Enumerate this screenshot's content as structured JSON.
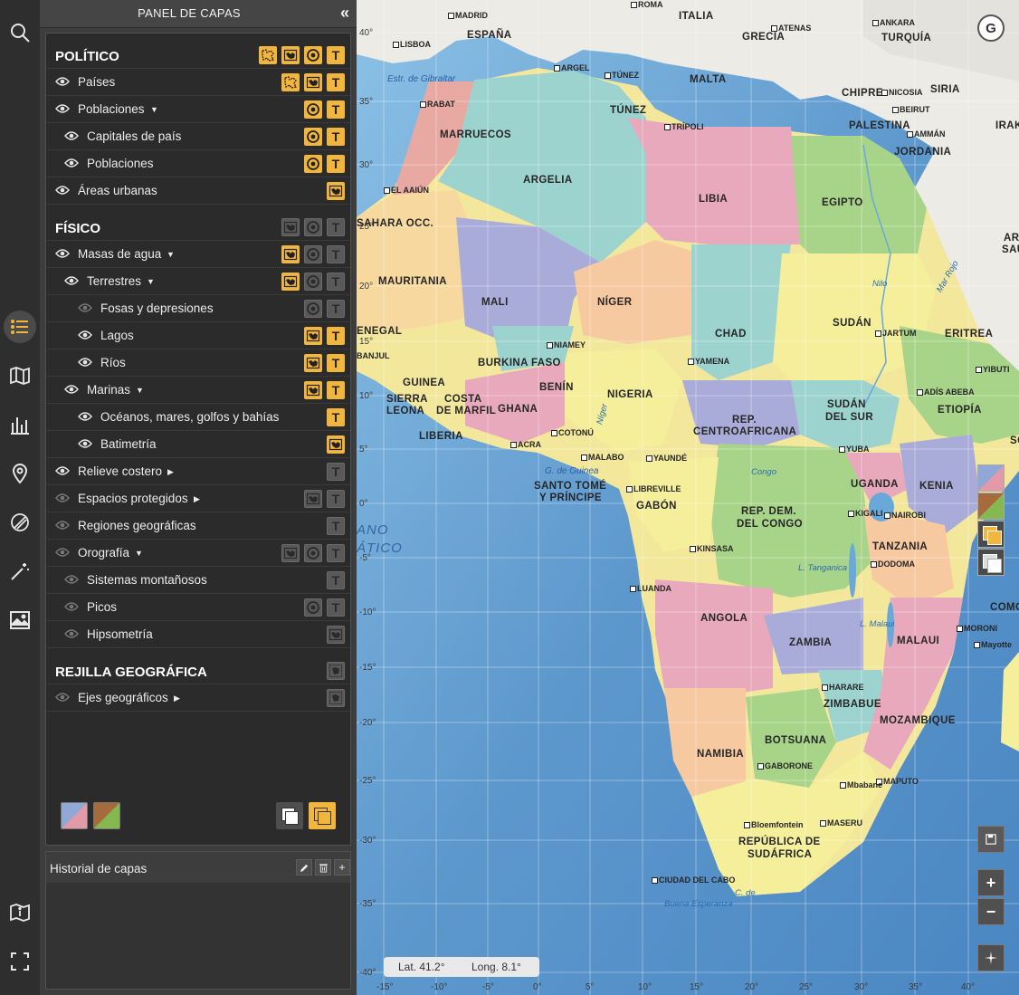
{
  "toolbar": {
    "tools": [
      {
        "name": "search-icon"
      },
      {
        "name": "layers-list-icon"
      },
      {
        "name": "map-catalog-icon"
      },
      {
        "name": "statistics-icon"
      },
      {
        "name": "location-pin-icon"
      },
      {
        "name": "drawing-icon"
      },
      {
        "name": "magic-wand-icon"
      },
      {
        "name": "image-icon"
      },
      {
        "name": "map-info-icon"
      },
      {
        "name": "fullscreen-icon"
      }
    ],
    "active_tool": "layers-list-icon",
    "accent": "#f2b63c"
  },
  "panel": {
    "title": "PANEL DE CAPAS",
    "collapse_glyph": "«"
  },
  "layers": [
    {
      "label": "POLÍTICO",
      "section": true,
      "btns": [
        [
          "areas",
          "on"
        ],
        [
          "map",
          "on"
        ],
        [
          "points",
          "on"
        ],
        [
          "text",
          "on"
        ]
      ]
    },
    {
      "label": "Países",
      "eye": "on",
      "indent": 0,
      "btns": [
        [
          "areas",
          "on"
        ],
        [
          "map",
          "on"
        ],
        [
          "text",
          "on"
        ]
      ]
    },
    {
      "label": "Poblaciones",
      "eye": "on",
      "indent": 0,
      "caret": "down",
      "btns": [
        [
          "points",
          "on"
        ],
        [
          "text",
          "on"
        ]
      ]
    },
    {
      "label": "Capitales de país",
      "eye": "on",
      "indent": 1,
      "btns": [
        [
          "points",
          "on"
        ],
        [
          "text",
          "on"
        ]
      ]
    },
    {
      "label": "Poblaciones",
      "eye": "on",
      "indent": 1,
      "btns": [
        [
          "points",
          "on"
        ],
        [
          "text",
          "on"
        ]
      ]
    },
    {
      "label": "Áreas urbanas",
      "eye": "on",
      "indent": 0,
      "btns": [
        [
          "map",
          "on"
        ]
      ]
    },
    {
      "label": "FÍSICO",
      "section": true,
      "btns": [
        [
          "map",
          "off"
        ],
        [
          "points",
          "off"
        ],
        [
          "text",
          "off"
        ]
      ]
    },
    {
      "label": "Masas de agua",
      "eye": "on",
      "indent": 0,
      "caret": "down",
      "btns": [
        [
          "map",
          "on"
        ],
        [
          "points",
          "off"
        ],
        [
          "text",
          "off"
        ]
      ]
    },
    {
      "label": "Terrestres",
      "eye": "on",
      "indent": 1,
      "caret": "down",
      "btns": [
        [
          "map",
          "on"
        ],
        [
          "points",
          "off"
        ],
        [
          "text",
          "off"
        ]
      ]
    },
    {
      "label": "Fosas y depresiones",
      "eye": "dim",
      "indent": 2,
      "btns": [
        [
          "points",
          "off"
        ],
        [
          "text",
          "off"
        ]
      ]
    },
    {
      "label": "Lagos",
      "eye": "on",
      "indent": 2,
      "btns": [
        [
          "map",
          "on"
        ],
        [
          "text",
          "on"
        ]
      ]
    },
    {
      "label": "Ríos",
      "eye": "on",
      "indent": 2,
      "btns": [
        [
          "map",
          "on"
        ],
        [
          "text",
          "on"
        ]
      ]
    },
    {
      "label": "Marinas",
      "eye": "on",
      "indent": 1,
      "caret": "down",
      "btns": [
        [
          "map",
          "on"
        ],
        [
          "text",
          "on"
        ]
      ]
    },
    {
      "label": "Océanos, mares, golfos y bahías",
      "eye": "on",
      "indent": 2,
      "btns": [
        [
          "text",
          "on"
        ]
      ]
    },
    {
      "label": "Batimetría",
      "eye": "on",
      "indent": 2,
      "btns": [
        [
          "map",
          "on"
        ]
      ]
    },
    {
      "label": "Relieve costero",
      "eye": "on",
      "indent": 0,
      "caret": "right",
      "btns": [
        [
          "text",
          "off"
        ]
      ]
    },
    {
      "label": "Espacios protegidos",
      "eye": "dim",
      "indent": 0,
      "caret": "right",
      "btns": [
        [
          "map",
          "off"
        ],
        [
          "text",
          "off"
        ]
      ]
    },
    {
      "label": "Regiones geográficas",
      "eye": "dim",
      "indent": 0,
      "btns": [
        [
          "text",
          "off"
        ]
      ]
    },
    {
      "label": "Orografía",
      "eye": "dim",
      "indent": 0,
      "caret": "down",
      "btns": [
        [
          "map",
          "off"
        ],
        [
          "points",
          "off"
        ],
        [
          "text",
          "off"
        ]
      ]
    },
    {
      "label": "Sistemas montañosos",
      "eye": "dim",
      "indent": 1,
      "btns": [
        [
          "text",
          "off"
        ]
      ]
    },
    {
      "label": "Picos",
      "eye": "dim",
      "indent": 1,
      "btns": [
        [
          "points",
          "off"
        ],
        [
          "text",
          "off"
        ]
      ]
    },
    {
      "label": "Hipsometría",
      "eye": "dim",
      "indent": 1,
      "btns": [
        [
          "map",
          "off"
        ]
      ]
    },
    {
      "label": "REJILLA GEOGRÁFICA",
      "section": true,
      "btns": [
        [
          "grid",
          "off"
        ]
      ]
    },
    {
      "label": "Ejes geográficos",
      "eye": "dim",
      "indent": 0,
      "caret": "right",
      "btns": [
        [
          "grid",
          "off"
        ]
      ]
    }
  ],
  "history": {
    "title": "Historial de capas",
    "edit_icon": "pencil-icon",
    "delete_icon": "trash-icon",
    "add_label": "+"
  },
  "map": {
    "countries": [
      {
        "t": "ESPAÑA"
      },
      {
        "t": "ITALIA"
      },
      {
        "t": "GRECIA"
      },
      {
        "t": "TURQUÍA"
      },
      {
        "t": "MALTA"
      },
      {
        "t": "CHIPRE"
      },
      {
        "t": "SIRIA"
      },
      {
        "t": "IRAK"
      },
      {
        "t": "PALESTINA"
      },
      {
        "t": "JORDANIA"
      },
      {
        "t": "TÚNEZ"
      },
      {
        "t": "MARRUECOS"
      },
      {
        "t": "ARGELIA"
      },
      {
        "t": "LIBIA"
      },
      {
        "t": "EGIPTO"
      },
      {
        "t": "ARABIA"
      },
      {
        "t": "SAUD"
      },
      {
        "t": "SAHARA OCC."
      },
      {
        "t": "MAURITANIA"
      },
      {
        "t": "MALI"
      },
      {
        "t": "NÍGER"
      },
      {
        "t": "CHAD"
      },
      {
        "t": "SUDÁN"
      },
      {
        "t": "ENEGAL"
      },
      {
        "t": "ERITREA"
      },
      {
        "t": "BURKINA FASO"
      },
      {
        "t": "GUINEA"
      },
      {
        "t": "SIERRA"
      },
      {
        "t": "LEONA"
      },
      {
        "t": "COSTA"
      },
      {
        "t": "DE MARFIL"
      },
      {
        "t": "LIBERIA"
      },
      {
        "t": "GHANA"
      },
      {
        "t": "BENÍN"
      },
      {
        "t": "NIGERIA"
      },
      {
        "t": "REP."
      },
      {
        "t": "CENTROAFRICANA"
      },
      {
        "t": "SUDÁN"
      },
      {
        "t": "DEL SUR"
      },
      {
        "t": "ETIOPÍA"
      },
      {
        "t": "SO"
      },
      {
        "t": "SANTO TOMÉ"
      },
      {
        "t": "Y PRÍNCIPE"
      },
      {
        "t": "GABÓN"
      },
      {
        "t": "REP. DEM."
      },
      {
        "t": "DEL CONGO"
      },
      {
        "t": "UGANDA"
      },
      {
        "t": "KENIA"
      },
      {
        "t": "TANZANIA"
      },
      {
        "t": "ANGOLA"
      },
      {
        "t": "ZAMBIA"
      },
      {
        "t": "MALAUI"
      },
      {
        "t": "ZIMBABUE"
      },
      {
        "t": "MOZAMBIQUE"
      },
      {
        "t": "NAMIBIA"
      },
      {
        "t": "BOTSUANA"
      },
      {
        "t": "REPÚBLICA DE"
      },
      {
        "t": "SUDÁFRICA"
      },
      {
        "t": "COMORAS"
      }
    ],
    "cities": [
      {
        "t": "MADRID"
      },
      {
        "t": "ROMA"
      },
      {
        "t": "LISBOA"
      },
      {
        "t": "ATENAS"
      },
      {
        "t": "ANKARA"
      },
      {
        "t": "NICOSIA"
      },
      {
        "t": "BEIRUT"
      },
      {
        "t": "AMMÁN"
      },
      {
        "t": "ARGEL"
      },
      {
        "t": "TÚNEZ"
      },
      {
        "t": "RABAT"
      },
      {
        "t": "TRÍPOLI"
      },
      {
        "t": "EL AAIÚN"
      },
      {
        "t": "JARTUM"
      },
      {
        "t": "NIAMEY"
      },
      {
        "t": "YAMENA"
      },
      {
        "t": "ADÍS ABEBA"
      },
      {
        "t": "YIBUTI"
      },
      {
        "t": "ACRA"
      },
      {
        "t": "COTONÚ"
      },
      {
        "t": "MALABO"
      },
      {
        "t": "YAUNDÉ"
      },
      {
        "t": "LIBREVILLE"
      },
      {
        "t": "YUBA"
      },
      {
        "t": "KIGALI"
      },
      {
        "t": "NAIROBI"
      },
      {
        "t": "KINSASA"
      },
      {
        "t": "DODOMA"
      },
      {
        "t": "LUANDA"
      },
      {
        "t": "MORONI"
      },
      {
        "t": "HARARE"
      },
      {
        "t": "GABORONE"
      },
      {
        "t": "MAPUTO"
      },
      {
        "t": "Mbabane"
      },
      {
        "t": "MASERU"
      },
      {
        "t": "Bloemfontein"
      },
      {
        "t": "CIUDAD DEL CABO"
      },
      {
        "t": "Mayotte"
      },
      {
        "t": "BANJUL"
      }
    ],
    "water": [
      {
        "t": "Estr. de Gibraltar"
      },
      {
        "t": "Mar Rojo"
      },
      {
        "t": "Nilo"
      },
      {
        "t": "Níger"
      },
      {
        "t": "G. de Guinea"
      },
      {
        "t": "Congo"
      },
      {
        "t": "L. Tanganica"
      },
      {
        "t": "L. Malaui"
      },
      {
        "t": "C. de"
      },
      {
        "t": "Buena Esperanza"
      },
      {
        "t": "ANO"
      },
      {
        "t": "ÁTICO"
      }
    ],
    "lat_labels": [
      "40°",
      "35°",
      "30°",
      "25°",
      "20°",
      "15°",
      "10°",
      "5°",
      "0°",
      "-5°",
      "-10°",
      "-15°",
      "-20°",
      "-25°",
      "-30°",
      "-35°",
      "-40°"
    ],
    "lon_labels": [
      "-15°",
      "-10°",
      "-5°",
      "0°",
      "5°",
      "10°",
      "15°",
      "20°",
      "25°",
      "30°",
      "35°",
      "40°"
    ],
    "coord": {
      "lat": "Lat. 41.2°",
      "long": "Long. 8.1°"
    },
    "zoom_in": "+",
    "zoom_out": "−",
    "compass_glyph": "G"
  }
}
